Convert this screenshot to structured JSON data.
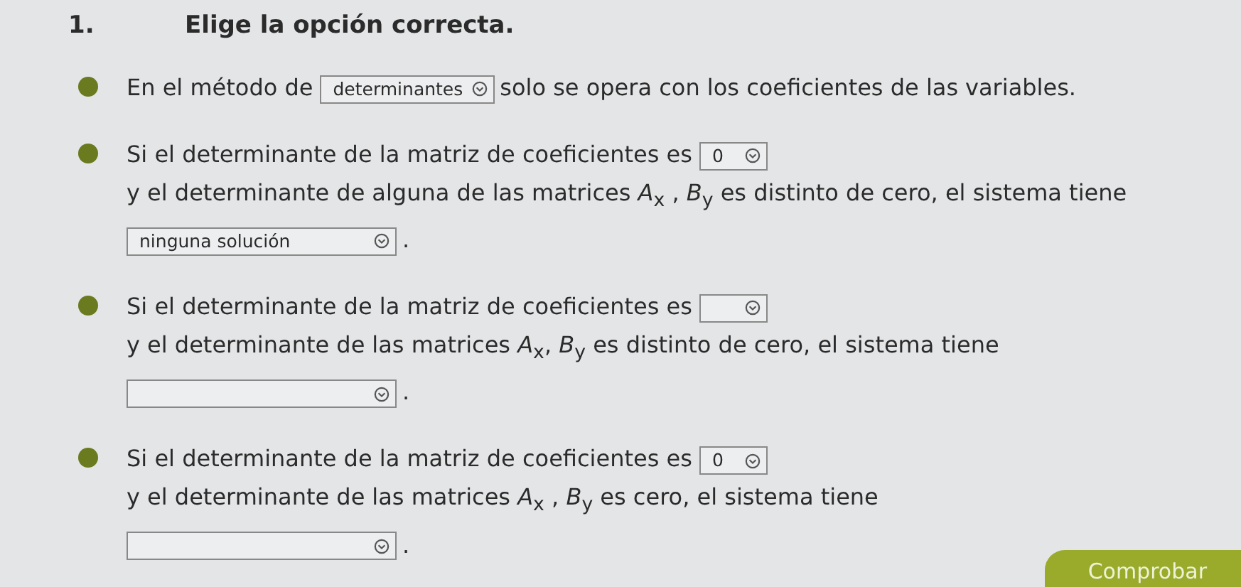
{
  "question": {
    "number": "1.",
    "title": "Elige la opción correcta."
  },
  "items": [
    {
      "segments": [
        {
          "kind": "text",
          "text": "En el método de"
        },
        {
          "kind": "select",
          "value": "determinantes"
        },
        {
          "kind": "text",
          "text": "solo se opera con los coeficientes de las"
        },
        {
          "kind": "text",
          "text": "variables."
        }
      ]
    },
    {
      "segments": [
        {
          "kind": "text",
          "text": "Si el determinante de la matriz de coeficientes es"
        },
        {
          "kind": "select",
          "value": "0"
        },
        {
          "kind": "text",
          "text": "y el determinante de"
        },
        {
          "kind": "text",
          "text": "alguna de las matrices *A*$_{x}$ , *B*$_{y}$ es distinto de cero, el sistema tiene"
        },
        {
          "kind": "longselect",
          "value": "ninguna solución"
        },
        {
          "kind": "text",
          "text": "."
        }
      ]
    },
    {
      "segments": [
        {
          "kind": "text",
          "text": "Si el determinante de la matriz de coeficientes es"
        },
        {
          "kind": "select"
        },
        {
          "kind": "text",
          "text": "y el determinante de"
        },
        {
          "kind": "text",
          "text": "las matrices *A*$_{x}$, *B*$_{y}$ es distinto de cero, el sistema tiene"
        },
        {
          "kind": "longselect"
        },
        {
          "kind": "text",
          "text": "."
        }
      ]
    },
    {
      "segments": [
        {
          "kind": "text",
          "text": "Si el determinante de la matriz de coeficientes es"
        },
        {
          "kind": "select",
          "value": "0"
        },
        {
          "kind": "text",
          "text": "y el determinante de"
        },
        {
          "kind": "text",
          "text": "las matrices *A*$_{x}$ , *B*$_{y}$ es cero, el sistema tiene"
        },
        {
          "kind": "longselect"
        },
        {
          "kind": "text",
          "text": "."
        }
      ]
    }
  ],
  "button": "Comprobar"
}
